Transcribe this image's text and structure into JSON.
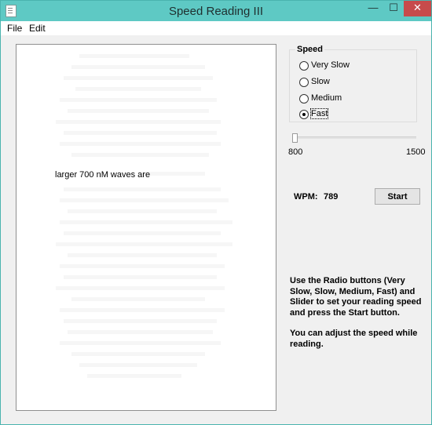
{
  "window": {
    "title": "Speed Reading III",
    "controls": {
      "minimize": "—",
      "maximize": "☐",
      "close": "✕"
    }
  },
  "menu": {
    "file": "File",
    "edit": "Edit"
  },
  "reading": {
    "current_text": "larger 700 nM waves are"
  },
  "speed": {
    "legend": "Speed",
    "options": [
      {
        "label": "Very Slow",
        "selected": false
      },
      {
        "label": "Slow",
        "selected": false
      },
      {
        "label": "Medium",
        "selected": false
      },
      {
        "label": "Fast",
        "selected": true
      }
    ],
    "slider_min": "800",
    "slider_max": "1500",
    "slider_position": 0
  },
  "wpm": {
    "label": "WPM:",
    "value": "789"
  },
  "start_label": "Start",
  "instructions": {
    "p1": "Use the Radio buttons (Very Slow, Slow, Medium, Fast) and Slider to set your reading speed and press the Start button.",
    "p2": "You can adjust the speed while reading."
  },
  "colors": {
    "titlebar": "#5ec9c4",
    "close_button": "#c74b4b"
  }
}
